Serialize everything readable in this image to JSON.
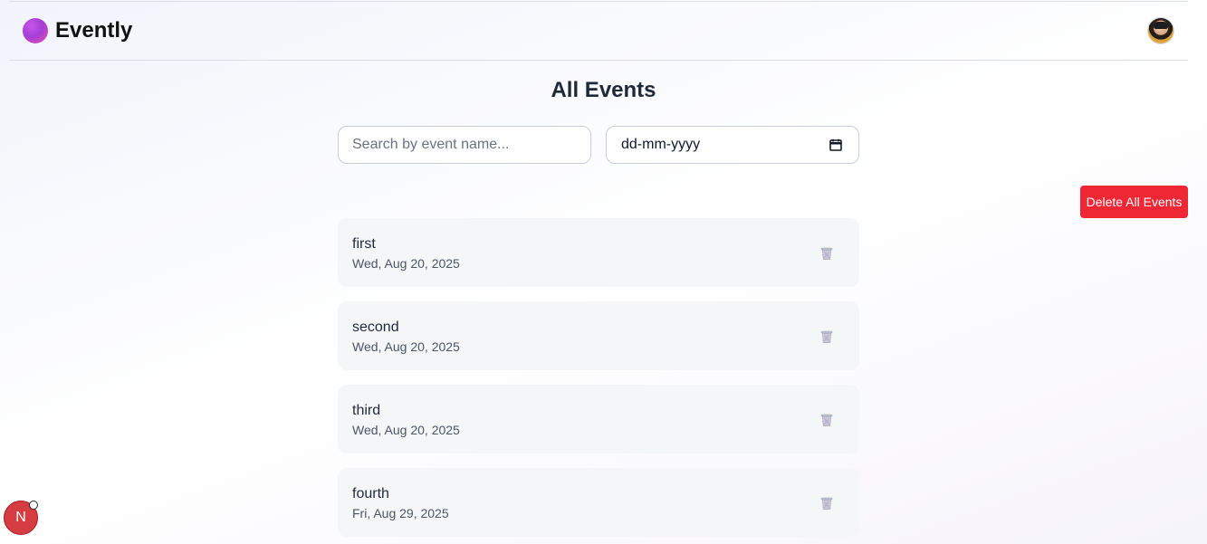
{
  "header": {
    "brand": "Evently"
  },
  "page": {
    "title": "All Events"
  },
  "filters": {
    "search_placeholder": "Search by event name...",
    "date_value": "dd-mm-yyyy"
  },
  "actions": {
    "delete_all_label": "Delete All Events"
  },
  "events": [
    {
      "name": "first",
      "date": "Wed, Aug 20, 2025"
    },
    {
      "name": "second",
      "date": "Wed, Aug 20, 2025"
    },
    {
      "name": "third",
      "date": "Wed, Aug 20, 2025"
    },
    {
      "name": "fourth",
      "date": "Fri, Aug 29, 2025"
    }
  ],
  "floating": {
    "badge_label": "N"
  },
  "icons": {
    "logo": "logo-dot-icon",
    "avatar": "user-avatar",
    "calendar": "calendar-icon",
    "trash": "trash-icon"
  },
  "colors": {
    "brand_gradient_start": "#c956e8",
    "brand_gradient_end": "#ea4fae",
    "danger": "#ef2634",
    "card": "#f5f6f8",
    "badge": "#d53d42"
  }
}
